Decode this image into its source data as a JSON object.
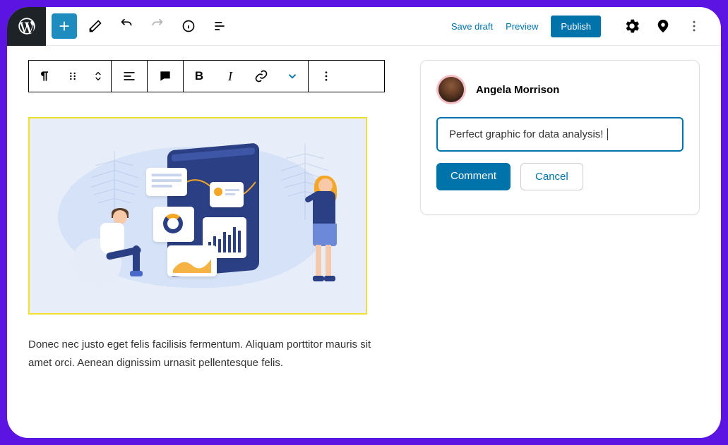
{
  "header": {
    "save_draft": "Save draft",
    "preview": "Preview",
    "publish": "Publish"
  },
  "body_text": "Donec nec justo eget felis facilisis fermentum. Aliquam porttitor mauris sit amet orci. Aenean dignissim urnasit pellentesque felis.",
  "comment_card": {
    "user_name": "Angela Morrison",
    "input_value": "Perfect graphic for data analysis!",
    "comment_btn": "Comment",
    "cancel_btn": "Cancel"
  }
}
